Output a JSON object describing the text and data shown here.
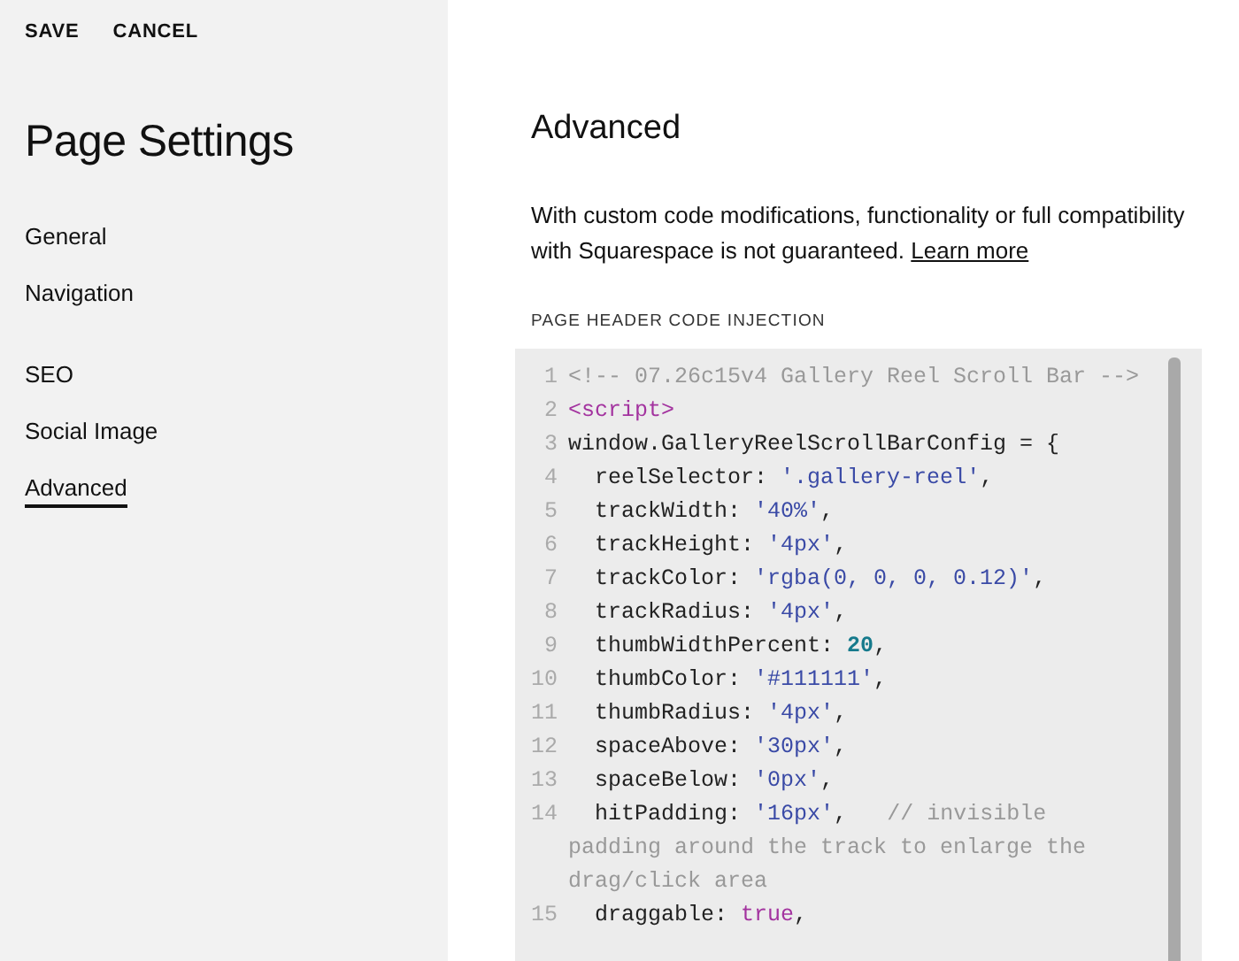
{
  "header_actions": [
    "SAVE",
    "CANCEL"
  ],
  "sidebar": {
    "title": "Page Settings",
    "groups": [
      {
        "items": [
          {
            "label": "General",
            "selected": false
          },
          {
            "label": "Navigation",
            "selected": false
          }
        ]
      },
      {
        "items": [
          {
            "label": "SEO",
            "selected": false
          },
          {
            "label": "Social Image",
            "selected": false
          },
          {
            "label": "Advanced",
            "selected": true
          }
        ]
      }
    ]
  },
  "main": {
    "title": "Advanced",
    "description": "With custom code modifications, functionality or full compatibility with Squarespace is not guaranteed.",
    "link": "Learn more",
    "section_label": "PAGE HEADER CODE INJECTION",
    "code_lines": [
      {
        "number": "1",
        "tokens": [
          {
            "kind": "comment",
            "text": "<!-- 07.26c15v4 Gallery Reel Scroll Bar -->"
          }
        ]
      },
      {
        "number": "2",
        "tokens": [
          {
            "kind": "tag",
            "text": "<script>"
          }
        ]
      },
      {
        "number": "3",
        "tokens": [
          {
            "kind": "plain",
            "text": "window.GalleryReelScrollBarConfig = {"
          }
        ]
      },
      {
        "number": "4",
        "tokens": [
          {
            "kind": "plain",
            "text": "  reelSelector: "
          },
          {
            "kind": "string",
            "text": "'.gallery-reel'"
          },
          {
            "kind": "plain",
            "text": ","
          }
        ]
      },
      {
        "number": "5",
        "tokens": [
          {
            "kind": "plain",
            "text": "  trackWidth: "
          },
          {
            "kind": "string",
            "text": "'40%'"
          },
          {
            "kind": "plain",
            "text": ","
          }
        ]
      },
      {
        "number": "6",
        "tokens": [
          {
            "kind": "plain",
            "text": "  trackHeight: "
          },
          {
            "kind": "string",
            "text": "'4px'"
          },
          {
            "kind": "plain",
            "text": ","
          }
        ]
      },
      {
        "number": "7",
        "tokens": [
          {
            "kind": "plain",
            "text": "  trackColor: "
          },
          {
            "kind": "string",
            "text": "'rgba(0, 0, 0, 0.12)'"
          },
          {
            "kind": "plain",
            "text": ","
          }
        ]
      },
      {
        "number": "8",
        "tokens": [
          {
            "kind": "plain",
            "text": "  trackRadius: "
          },
          {
            "kind": "string",
            "text": "'4px'"
          },
          {
            "kind": "plain",
            "text": ","
          }
        ]
      },
      {
        "number": "9",
        "tokens": [
          {
            "kind": "plain",
            "text": "  thumbWidthPercent: "
          },
          {
            "kind": "number",
            "text": "20"
          },
          {
            "kind": "plain",
            "text": ","
          }
        ]
      },
      {
        "number": "10",
        "tokens": [
          {
            "kind": "plain",
            "text": "  thumbColor: "
          },
          {
            "kind": "string",
            "text": "'#111111'"
          },
          {
            "kind": "plain",
            "text": ","
          }
        ]
      },
      {
        "number": "11",
        "tokens": [
          {
            "kind": "plain",
            "text": "  thumbRadius: "
          },
          {
            "kind": "string",
            "text": "'4px'"
          },
          {
            "kind": "plain",
            "text": ","
          }
        ]
      },
      {
        "number": "12",
        "tokens": [
          {
            "kind": "plain",
            "text": "  spaceAbove: "
          },
          {
            "kind": "string",
            "text": "'30px'"
          },
          {
            "kind": "plain",
            "text": ","
          }
        ]
      },
      {
        "number": "13",
        "tokens": [
          {
            "kind": "plain",
            "text": "  spaceBelow: "
          },
          {
            "kind": "string",
            "text": "'0px'"
          },
          {
            "kind": "plain",
            "text": ","
          }
        ]
      },
      {
        "number": "14",
        "tokens": [
          {
            "kind": "plain",
            "text": "  hitPadding: "
          },
          {
            "kind": "string",
            "text": "'16px'"
          },
          {
            "kind": "plain",
            "text": ",   "
          },
          {
            "kind": "comment",
            "text": "// invisible padding around the track to enlarge the drag/click area"
          }
        ]
      },
      {
        "number": "15",
        "tokens": [
          {
            "kind": "plain",
            "text": "  draggable: "
          },
          {
            "kind": "keyword",
            "text": "true"
          },
          {
            "kind": "plain",
            "text": ","
          }
        ]
      }
    ]
  }
}
